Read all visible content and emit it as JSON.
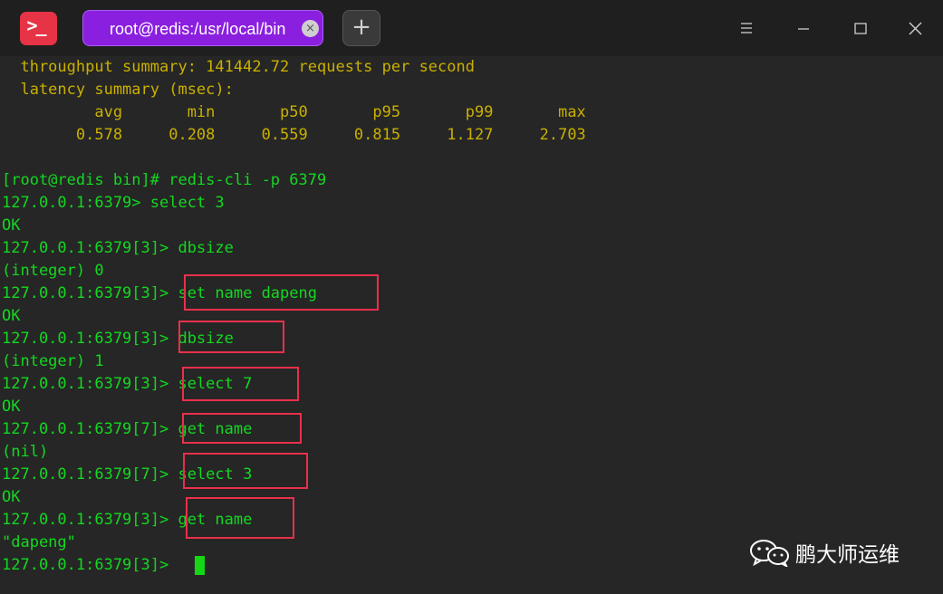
{
  "window": {
    "tab_title": "root@redis:/usr/local/bin",
    "app_icon_glyph": ">_",
    "new_tab_glyph": "+",
    "tab_close_glyph": "×"
  },
  "terminal": {
    "lines": [
      "  throughput summary: 141442.72 requests per second",
      "  latency summary (msec):",
      "          avg       min       p50       p95       p99       max",
      "        0.578     0.208     0.559     0.815     1.127     2.703",
      "",
      "[root@redis bin]# redis-cli -p 6379",
      "127.0.0.1:6379> select 3",
      "OK",
      "127.0.0.1:6379[3]> dbsize",
      "(integer) 0",
      "127.0.0.1:6379[3]> set name dapeng",
      "OK",
      "127.0.0.1:6379[3]> dbsize",
      "(integer) 1",
      "127.0.0.1:6379[3]> select 7",
      "OK",
      "127.0.0.1:6379[7]> get name",
      "(nil)",
      "127.0.0.1:6379[7]> select 3",
      "OK",
      "127.0.0.1:6379[3]> get name",
      "\"dapeng\"",
      "127.0.0.1:6379[3]> "
    ]
  },
  "colors": {
    "terminal_text": "#13d820",
    "summary_text": "#c9b000",
    "highlight_box": "#e8304b",
    "tab_active": "#8b1fe0",
    "app_icon": "#e63346"
  },
  "watermark": {
    "text": "鹏大师运维"
  }
}
